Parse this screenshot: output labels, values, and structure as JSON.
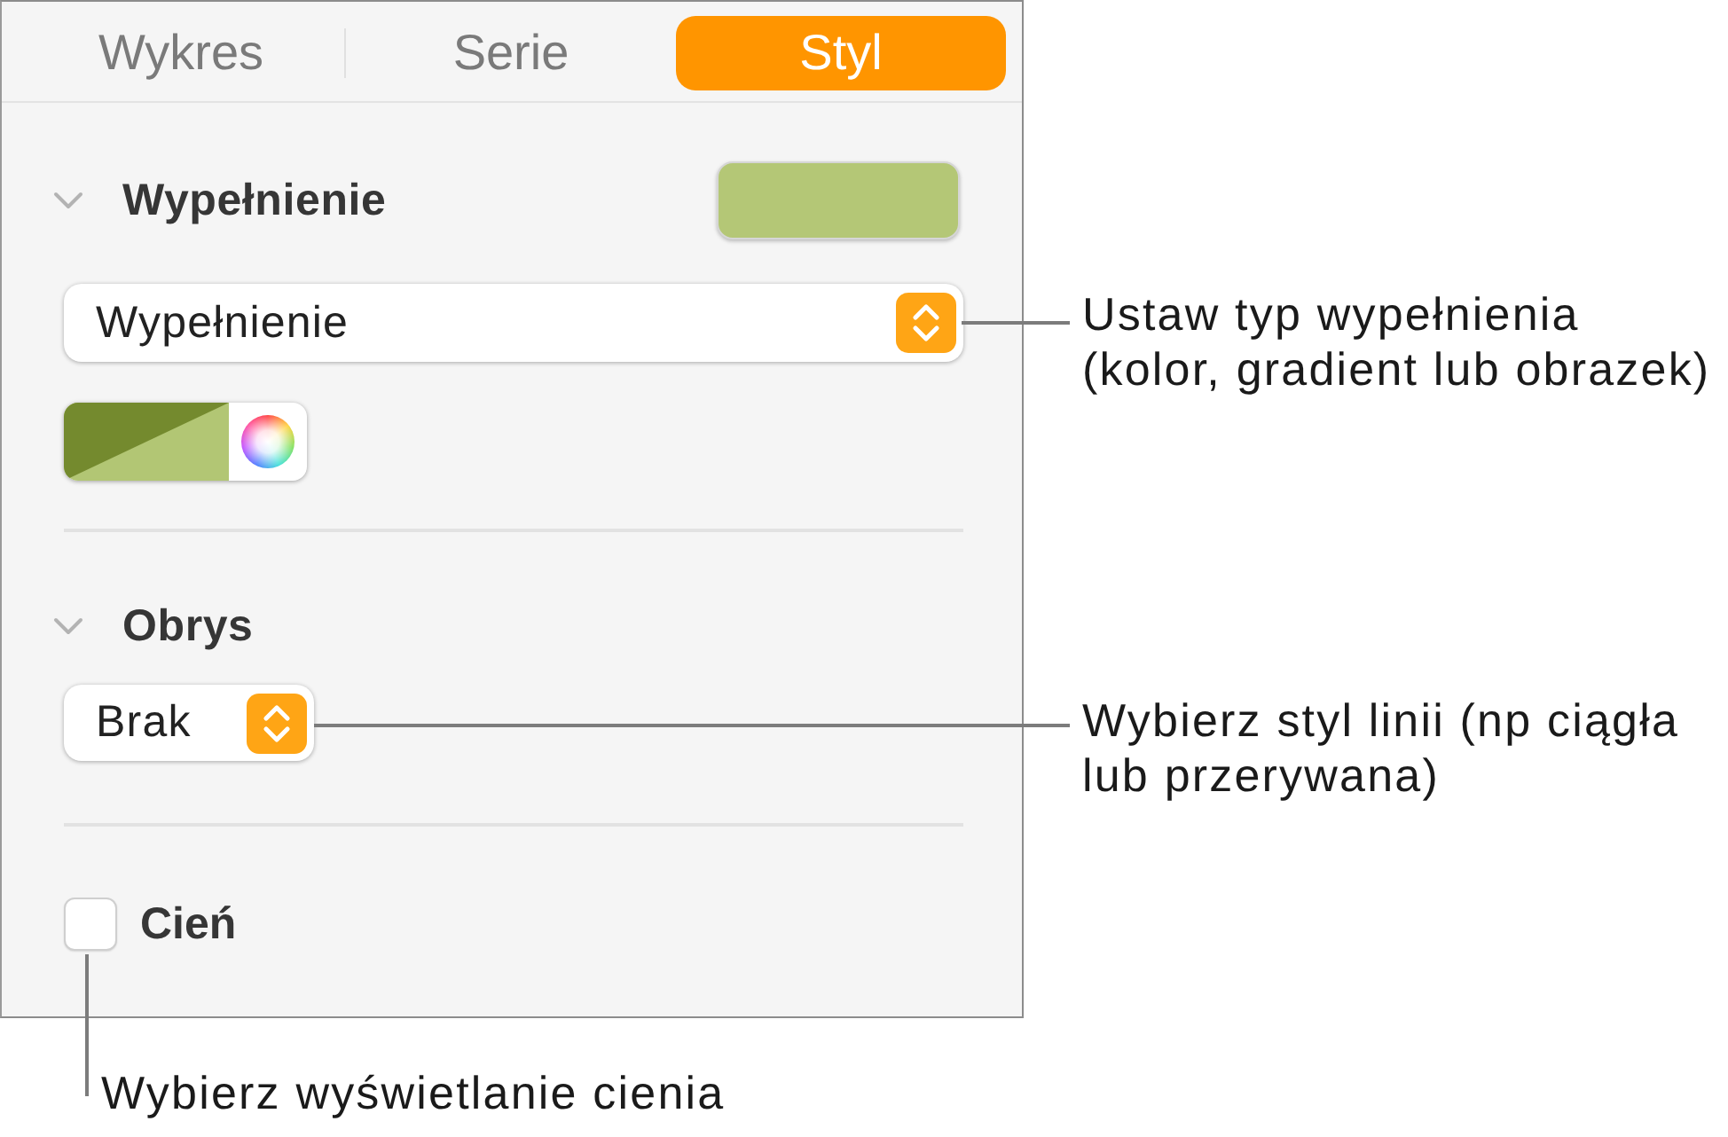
{
  "tabs": [
    {
      "label": "Wykres",
      "selected": false
    },
    {
      "label": "Serie",
      "selected": false
    },
    {
      "label": "Styl",
      "selected": true
    }
  ],
  "fill": {
    "title": "Wypełnienie",
    "expanded": true,
    "fill_type": "Wypełnienie"
  },
  "stroke": {
    "title": "Obrys",
    "expanded": true,
    "line_style": "Brak"
  },
  "shadow": {
    "label": "Cień",
    "checked": false
  },
  "callouts": [
    {
      "text": "Ustaw typ wypełnienia\n(kolor, gradient lub obrazek)"
    },
    {
      "text": "Wybierz styl linii (np ciągła\nlub przerywana)"
    },
    {
      "text": "Wybierz wyświetlanie cienia"
    }
  ]
}
